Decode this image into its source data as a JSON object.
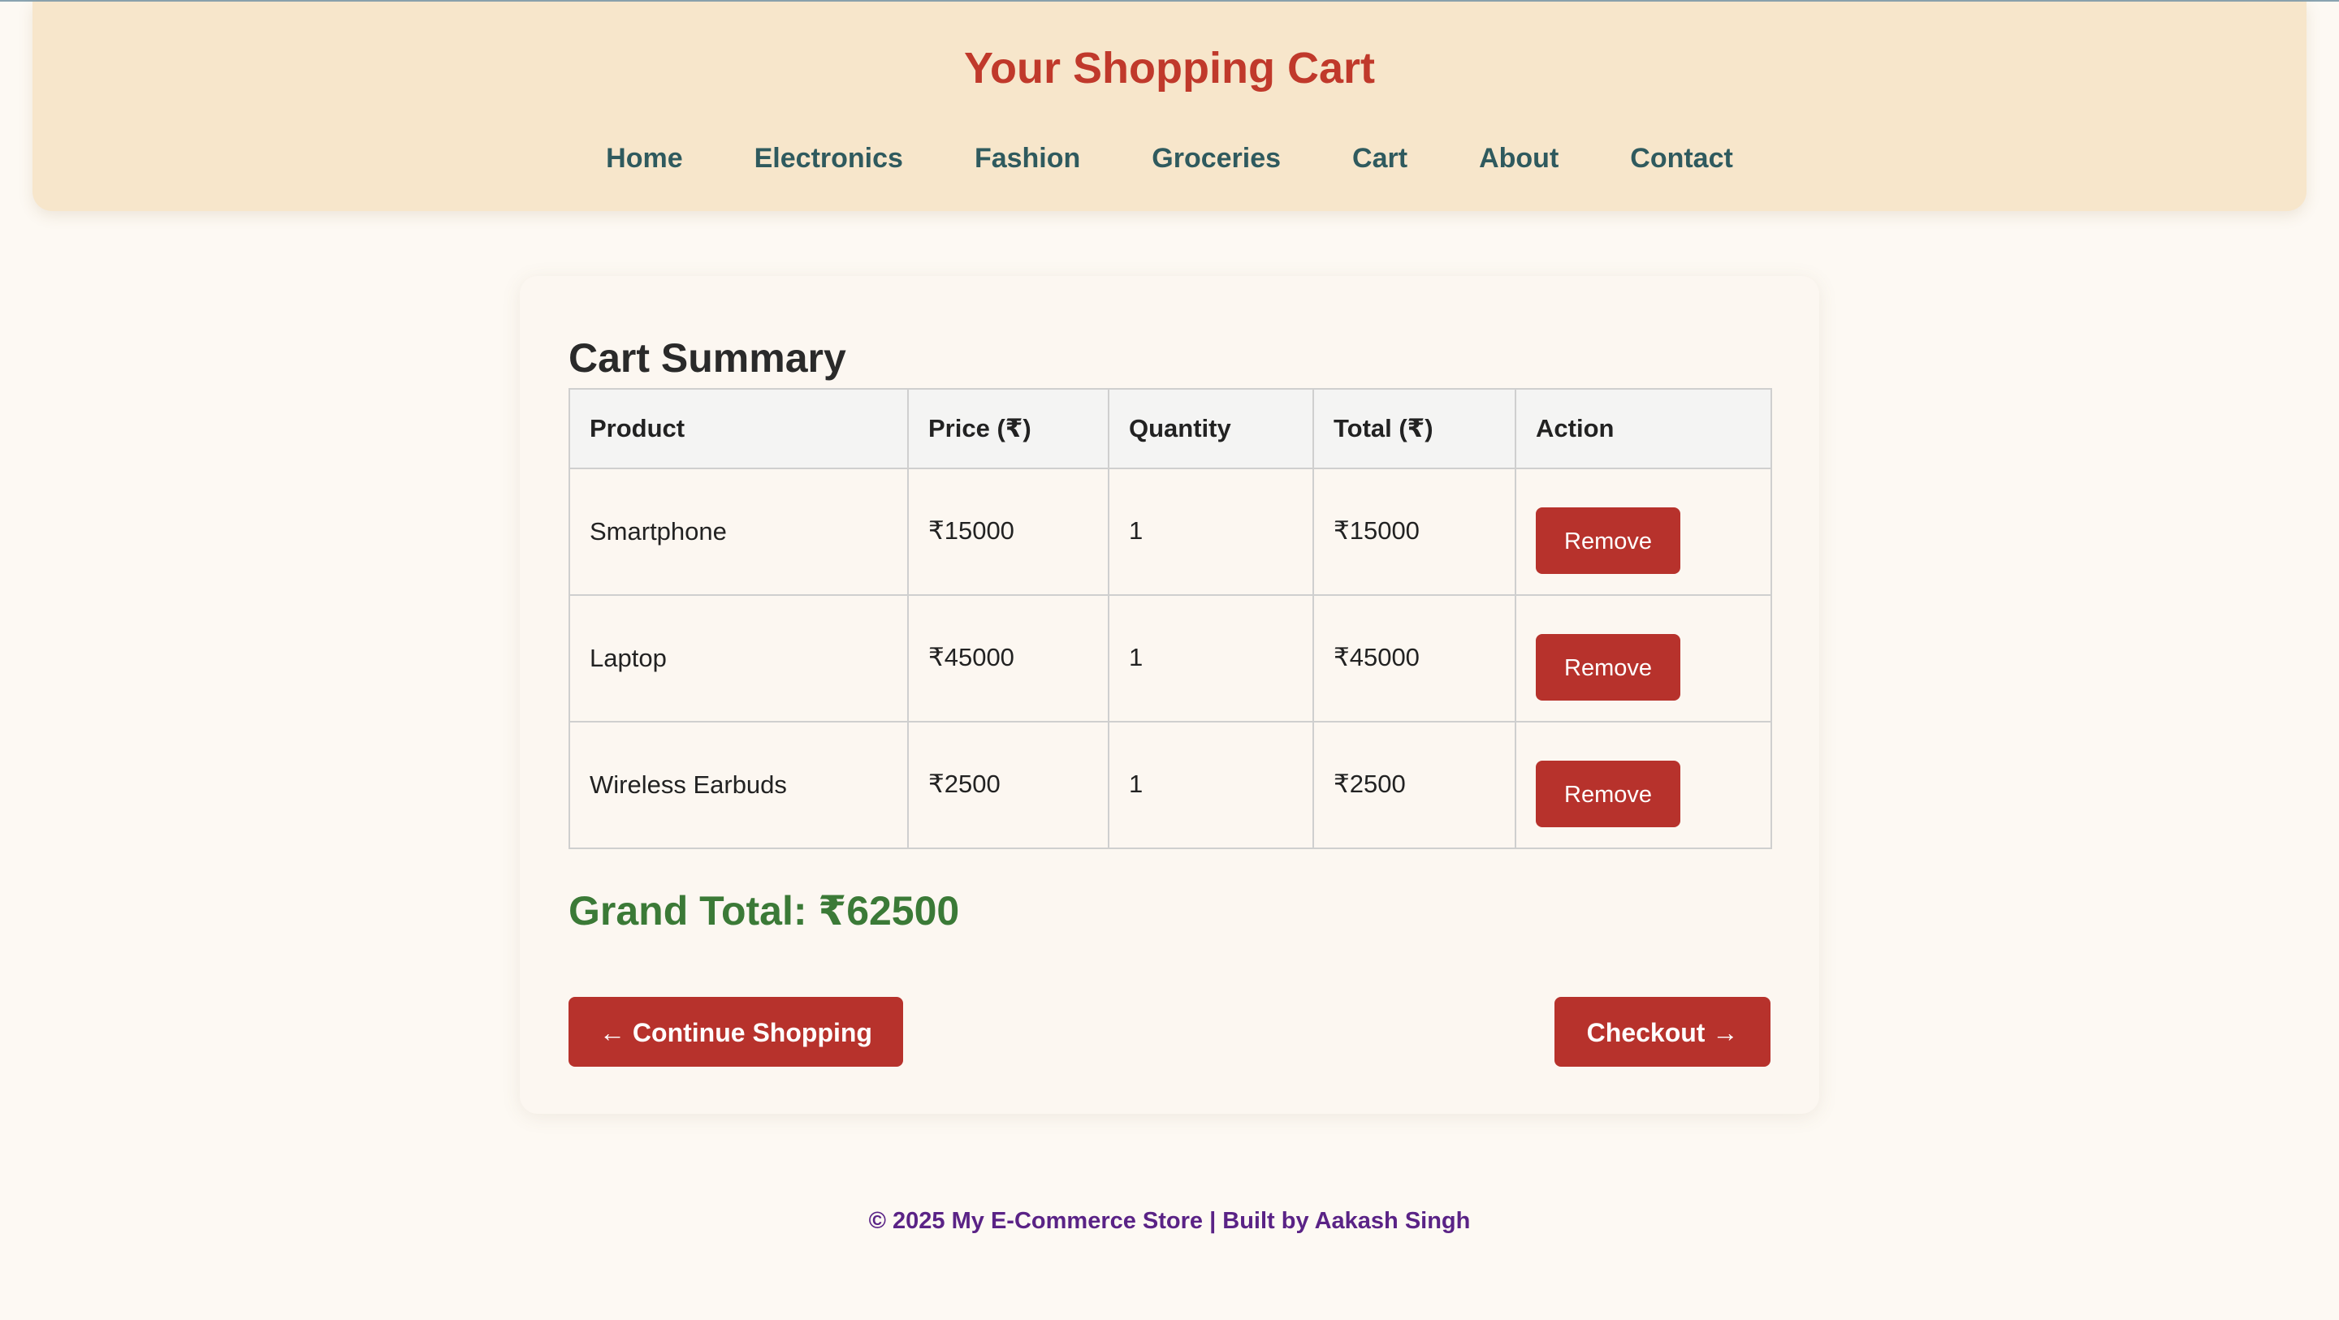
{
  "header": {
    "title": "Your Shopping Cart",
    "nav": [
      "Home",
      "Electronics",
      "Fashion",
      "Groceries",
      "Cart",
      "About",
      "Contact"
    ]
  },
  "cart": {
    "heading": "Cart Summary",
    "columns": [
      "Product",
      "Price (₹)",
      "Quantity",
      "Total (₹)",
      "Action"
    ],
    "rows": [
      {
        "product": "Smartphone",
        "price": "₹15000",
        "quantity": "1",
        "total": "₹15000",
        "action": "Remove"
      },
      {
        "product": "Laptop",
        "price": "₹45000",
        "quantity": "1",
        "total": "₹45000",
        "action": "Remove"
      },
      {
        "product": "Wireless Earbuds",
        "price": "₹2500",
        "quantity": "1",
        "total": "₹2500",
        "action": "Remove"
      }
    ],
    "grand_total": "Grand Total: ₹62500",
    "continue_label": "← Continue Shopping",
    "checkout_label": "Checkout →"
  },
  "footer": {
    "text": "© 2025 My E-Commerce Store | Built by Aakash Singh"
  },
  "colors": {
    "accent": "#b7322c",
    "title": "#c0392b",
    "nav": "#2f5a5e",
    "grand_total": "#3b7a37",
    "footer": "#5a2386",
    "header_bg": "#f7e6cb"
  }
}
